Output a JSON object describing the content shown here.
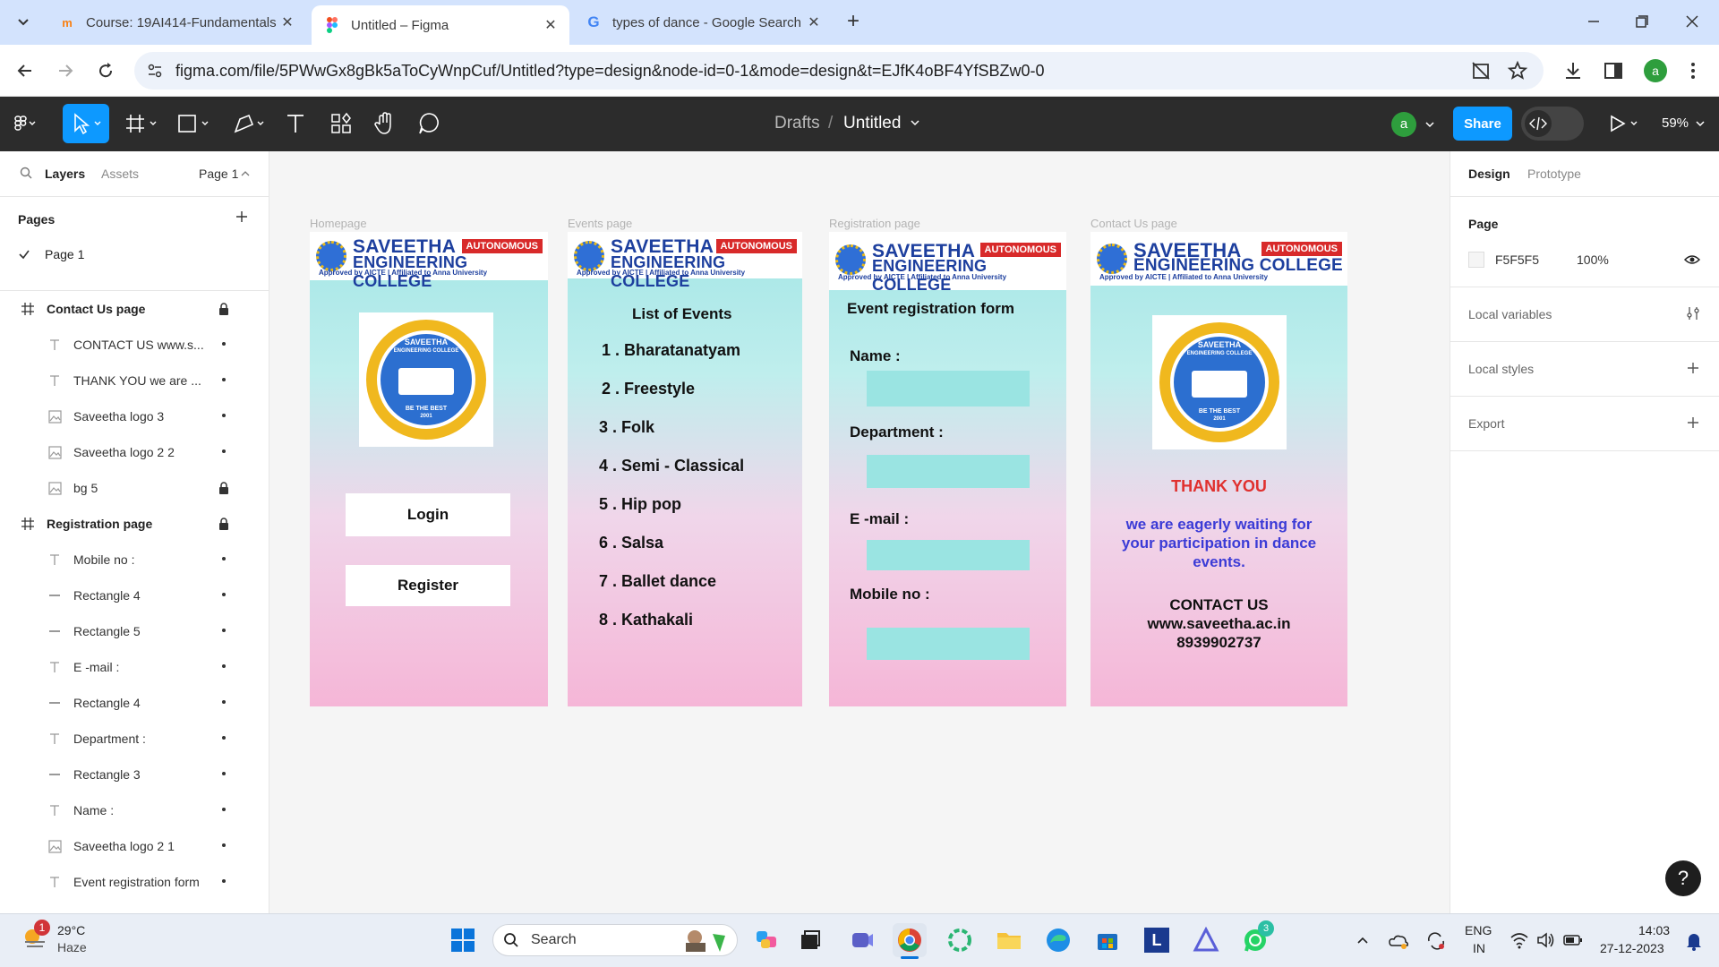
{
  "browser": {
    "tabs": [
      {
        "title": "Course: 19AI414-Fundamentals",
        "active": false
      },
      {
        "title": "Untitled – Figma",
        "active": true
      },
      {
        "title": "types of dance - Google Search",
        "active": false
      }
    ],
    "url": "figma.com/file/5PWwGx8gBk5aToCyWnpCuf/Untitled?type=design&node-id=0-1&mode=design&t=EJfK4oBF4YfSBZw0-0",
    "profile_initial": "a"
  },
  "figma": {
    "breadcrumb_root": "Drafts",
    "breadcrumb_sep": "/",
    "file_name": "Untitled",
    "user_initial": "a",
    "share_label": "Share",
    "zoom": "59%"
  },
  "left_panel": {
    "tab_layers": "Layers",
    "tab_assets": "Assets",
    "page_selector": "Page 1",
    "pages_heading": "Pages",
    "pages": [
      "Page 1"
    ],
    "layers": [
      {
        "name": "Contact Us page",
        "kind": "frame",
        "locked": true
      },
      {
        "name": "CONTACT US www.s...",
        "kind": "text"
      },
      {
        "name": "THANK YOU we are ...",
        "kind": "text"
      },
      {
        "name": "Saveetha logo 3",
        "kind": "image"
      },
      {
        "name": "Saveetha logo 2 2",
        "kind": "image"
      },
      {
        "name": "bg 5",
        "kind": "image",
        "locked": true
      },
      {
        "name": "Registration page",
        "kind": "frame",
        "locked": true
      },
      {
        "name": "Mobile no :",
        "kind": "text"
      },
      {
        "name": "Rectangle 4",
        "kind": "rect"
      },
      {
        "name": "Rectangle 5",
        "kind": "rect"
      },
      {
        "name": "E -mail :",
        "kind": "text"
      },
      {
        "name": "Rectangle 4",
        "kind": "rect"
      },
      {
        "name": "Department :",
        "kind": "text"
      },
      {
        "name": "Rectangle 3",
        "kind": "rect"
      },
      {
        "name": "Name :",
        "kind": "text"
      },
      {
        "name": "Saveetha logo 2 1",
        "kind": "image"
      },
      {
        "name": "Event registration form",
        "kind": "text"
      }
    ]
  },
  "right_panel": {
    "tab_design": "Design",
    "tab_prototype": "Prototype",
    "page_heading": "Page",
    "page_color": "F5F5F5",
    "page_opacity": "100%",
    "local_variables": "Local variables",
    "local_styles": "Local styles",
    "export": "Export"
  },
  "college": {
    "name_line1": "SAVEETHA",
    "name_line2": "ENGINEERING COLLEGE",
    "badge": "AUTONOMOUS",
    "approval": "Approved by AICTE | Affiliated to Anna University",
    "logo_top": "SAVEETHA",
    "logo_sub": "ENGINEERING COLLEGE",
    "logo_motto": "BE THE BEST",
    "logo_year": "2001"
  },
  "frames": {
    "home": {
      "label": "Homepage",
      "login": "Login",
      "register": "Register"
    },
    "events": {
      "label": "Events page",
      "heading": "List of Events",
      "items": [
        "1 .  Bharatanatyam",
        "2 . Freestyle",
        "3 . Folk",
        "4 . Semi - Classical",
        "5 . Hip pop",
        "6 . Salsa",
        "7 . Ballet dance",
        "8 . Kathakali"
      ]
    },
    "registration": {
      "label": "Registration page",
      "heading": "Event  registration form",
      "name": "Name :",
      "department": "Department :",
      "email": "E -mail :",
      "mobile": "Mobile no :"
    },
    "contact": {
      "label": "Contact Us page",
      "thanks": "THANK YOU",
      "message": "we are eagerly waiting for your participation in dance events.",
      "contact_heading": "CONTACT US",
      "website": "www.saveetha.ac.in",
      "phone": "8939902737"
    }
  },
  "taskbar": {
    "weather_temp": "29°C",
    "weather_desc": "Haze",
    "weather_badge": "1",
    "search_label": "Search",
    "lang": "ENG",
    "region": "IN",
    "time": "14:03",
    "date": "27-12-2023",
    "whatsapp_badge": "3",
    "l_app_letter": "L"
  },
  "colors": {
    "figma_toolbar": "#2c2c2c",
    "share_button": "#0d99ff",
    "thank_you": "#e0302e",
    "message": "#3b3bd6",
    "field": "#9ae4e2"
  }
}
